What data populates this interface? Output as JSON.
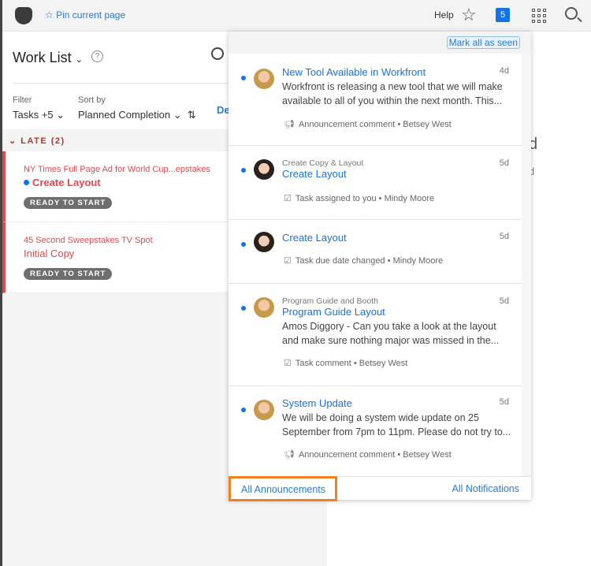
{
  "topbar": {
    "pin": "Pin current page",
    "help": "Help",
    "notif_count": "5"
  },
  "worklist": {
    "title": "Work List",
    "help": "?",
    "filter_label": "Filter",
    "filter_value": "Tasks +5",
    "sort_label": "Sort by",
    "sort_value": "Planned Completion",
    "partial_link": "De",
    "group": "LATE (2)",
    "tasks": [
      {
        "project": "NY Times Full Page Ad for World Cup...epstakes",
        "name": "Create Layout",
        "status": "READY TO START"
      },
      {
        "project": "45 Second Sweepstakes TV Spot",
        "name": "Initial Copy",
        "status": "READY TO START"
      }
    ]
  },
  "background": {
    "t1": "d",
    "t2": "d"
  },
  "popup": {
    "mark_all": "Mark all as seen",
    "items": [
      {
        "context": "",
        "title": "New Tool Available in Workfront",
        "age": "4d",
        "body": "Workfront is releasing a new tool that we will make available to all of you within the next month. This...",
        "type": "Announcement comment",
        "author": "Betsey West",
        "icon": "megaphone-icon"
      },
      {
        "context": "Create Copy & Layout",
        "title": "Create Layout",
        "age": "5d",
        "body": "",
        "type": "Task assigned to you",
        "author": "Mindy Moore",
        "icon": "task-icon"
      },
      {
        "context": "",
        "title": "Create Layout",
        "age": "5d",
        "body": "",
        "type": "Task due date changed",
        "author": "Mindy Moore",
        "icon": "task-icon"
      },
      {
        "context": "Program Guide and Booth",
        "title": "Program Guide Layout",
        "age": "5d",
        "body": "Amos Diggory - Can you take a look at the layout and make sure nothing major was missed in the...",
        "type": "Task comment",
        "author": "Betsey West",
        "icon": "task-icon"
      },
      {
        "context": "",
        "title": "System Update",
        "age": "5d",
        "body": "We will be doing a system wide update on 25 September from 7pm to 11pm. Please do not try to...",
        "type": "Announcement comment",
        "author": "Betsey West",
        "icon": "megaphone-icon"
      }
    ],
    "all_announcements": "All Announcements",
    "all_notifications": "All Notifications"
  },
  "colors": {
    "accent": "#1473e6",
    "late": "#e34850",
    "highlight": "#f48120"
  }
}
